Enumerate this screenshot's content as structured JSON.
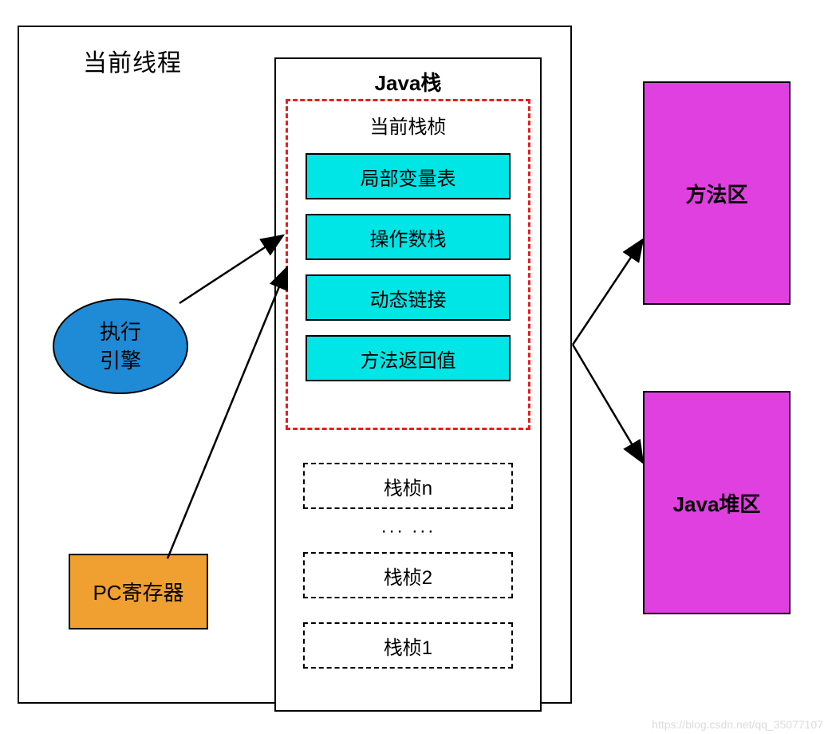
{
  "thread": {
    "title": "当前线程",
    "engine": "执行\n引擎",
    "pc_register": "PC寄存器"
  },
  "java_stack": {
    "title": "Java栈",
    "current_frame": {
      "title": "当前栈桢",
      "items": {
        "local_vars": "局部变量表",
        "operand_stack": "操作数栈",
        "dynamic_link": "动态链接",
        "return_value": "方法返回值"
      }
    },
    "frames": {
      "n": "栈桢n",
      "dots": "··· ···",
      "f2": "栈桢2",
      "f1": "栈桢1"
    }
  },
  "method_area": "方法区",
  "heap_area": "Java堆区",
  "watermark": "https://blog.csdn.net/qq_35077107"
}
